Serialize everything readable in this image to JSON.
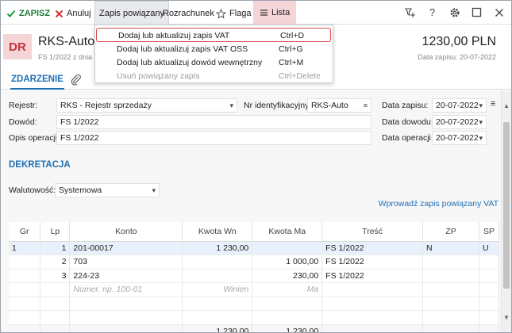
{
  "toolbar": {
    "save": "ZAPISZ",
    "cancel": "Anuluj",
    "related": "Zapis powiązany",
    "settlement": "Rozrachunek",
    "flag": "Flaga",
    "list": "Lista",
    "right_icons": [
      "add-filter-icon",
      "help-icon",
      "gear-icon",
      "maximize-icon",
      "close-icon"
    ],
    "help_glyph": "?"
  },
  "header": {
    "badge": "DR",
    "title": "RKS-Auto",
    "subtitle": "FS 1/2022 z dnia",
    "amount": "1230,00 PLN",
    "date_label": "Data zapisu: 20-07-2022"
  },
  "tabs": {
    "event": "ZDARZENIE"
  },
  "menu": {
    "items": [
      {
        "label": "Dodaj lub aktualizuj zapis VAT",
        "shortcut": "Ctrl+D"
      },
      {
        "label": "Dodaj lub aktualizuj zapis VAT OSS",
        "shortcut": "Ctrl+G"
      },
      {
        "label": "Dodaj lub aktualizuj dowód wewnętrzny",
        "shortcut": "Ctrl+M"
      },
      {
        "label": "Usuń powiązany zapis",
        "shortcut": "Ctrl+Delete"
      }
    ]
  },
  "form": {
    "register_label": "Rejestr:",
    "register_value": "RKS - Rejestr sprzedaży",
    "id_label": "Nr identyfikacyjny:",
    "id_value": "RKS-Auto",
    "record_date_label": "Data zapisu:",
    "record_date": "20-07-2022",
    "proof_label": "Dowód:",
    "proof_value": "FS 1/2022",
    "proof_date_label": "Data dowodu:",
    "proof_date": "20-07-2022",
    "desc_label": "Opis operacji:",
    "desc_value": "FS 1/2022",
    "op_date_label": "Data operacji:",
    "op_date": "20-07-2022"
  },
  "posting": {
    "title": "DEKRETACJA",
    "currency_label": "Walutowość:",
    "currency_value": "Systemowa",
    "link": "Wprowadź zapis powiązany VAT"
  },
  "table": {
    "headers": [
      "Gr",
      "Lp",
      "Konto",
      "Kwota Wn",
      "Kwota Ma",
      "Treść",
      "ZP",
      "SP"
    ],
    "rows": [
      [
        "1",
        "1",
        "201-00017",
        "1 230,00",
        "",
        "FS 1/2022",
        "N",
        "U"
      ],
      [
        "",
        "2",
        "703",
        "",
        "1 000,00",
        "FS 1/2022",
        "",
        ""
      ],
      [
        "",
        "3",
        "224-23",
        "",
        "230,00",
        "FS 1/2022",
        "",
        ""
      ]
    ],
    "placeholder": {
      "account": "Numer, np. 100-01",
      "debit": "Winien",
      "credit": "Ma"
    },
    "totals": {
      "debit": "1 230,00",
      "credit": "1 230,00"
    }
  }
}
